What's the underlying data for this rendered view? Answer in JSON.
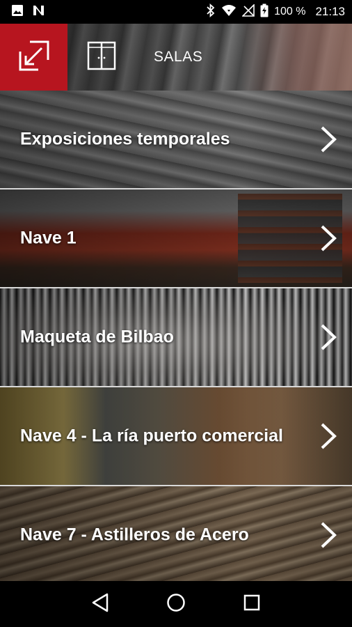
{
  "status_bar": {
    "battery_percent": "100 %",
    "time": "21:13",
    "icons": [
      "image-icon",
      "n-app-icon",
      "bluetooth-icon",
      "wifi-icon",
      "no-signal-icon",
      "battery-charging-icon"
    ]
  },
  "header": {
    "title": "SALAS",
    "exit_icon": "exit-arrow-icon",
    "map_icon": "door-map-icon",
    "accent_color": "#b7151f"
  },
  "rooms": [
    {
      "label": "Exposiciones temporales"
    },
    {
      "label": "Nave 1"
    },
    {
      "label": "Maqueta de Bilbao"
    },
    {
      "label": "Nave 4 - La ría puerto comercial"
    },
    {
      "label": "Nave 7 - Astilleros de Acero"
    }
  ],
  "nav_bar": {
    "icons": [
      "back-icon",
      "home-icon",
      "recents-icon"
    ]
  }
}
